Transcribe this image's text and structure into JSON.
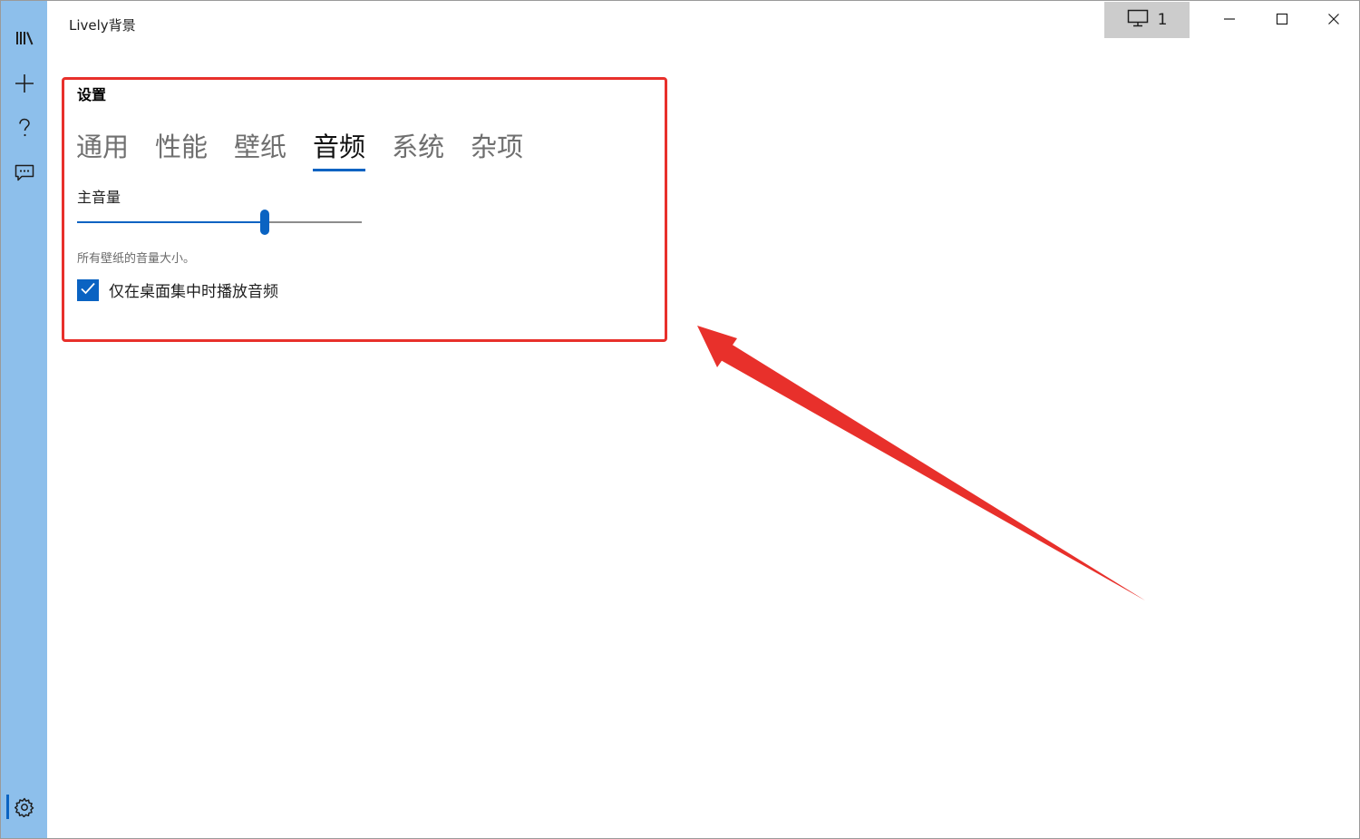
{
  "window": {
    "title": "Lively背景",
    "monitor_count": "1",
    "monitor_icon": "monitor-icon",
    "caption_buttons": [
      "minimize-icon",
      "maximize-icon",
      "close-icon"
    ]
  },
  "sidebar": {
    "items": [
      {
        "icon": "library-icon"
      },
      {
        "icon": "add-icon"
      },
      {
        "icon": "help-icon"
      },
      {
        "icon": "feedback-icon"
      }
    ],
    "settings_icon": "gear-icon",
    "active": "settings"
  },
  "settings": {
    "title": "设置",
    "tabs": [
      "通用",
      "性能",
      "壁纸",
      "音频",
      "系统",
      "杂项"
    ],
    "active_tab": "音频",
    "volume": {
      "label": "主音量",
      "value_fraction": 0.66,
      "description": "所有壁纸的音量大小。"
    },
    "checkbox": {
      "label": "仅在桌面集中时播放音频",
      "checked": true
    }
  },
  "colors": {
    "sidebar_bg": "#8dbfeb",
    "accent": "#0a63c2",
    "annotation_red": "#e8302b",
    "monitor_button_bg": "#cccccc"
  }
}
